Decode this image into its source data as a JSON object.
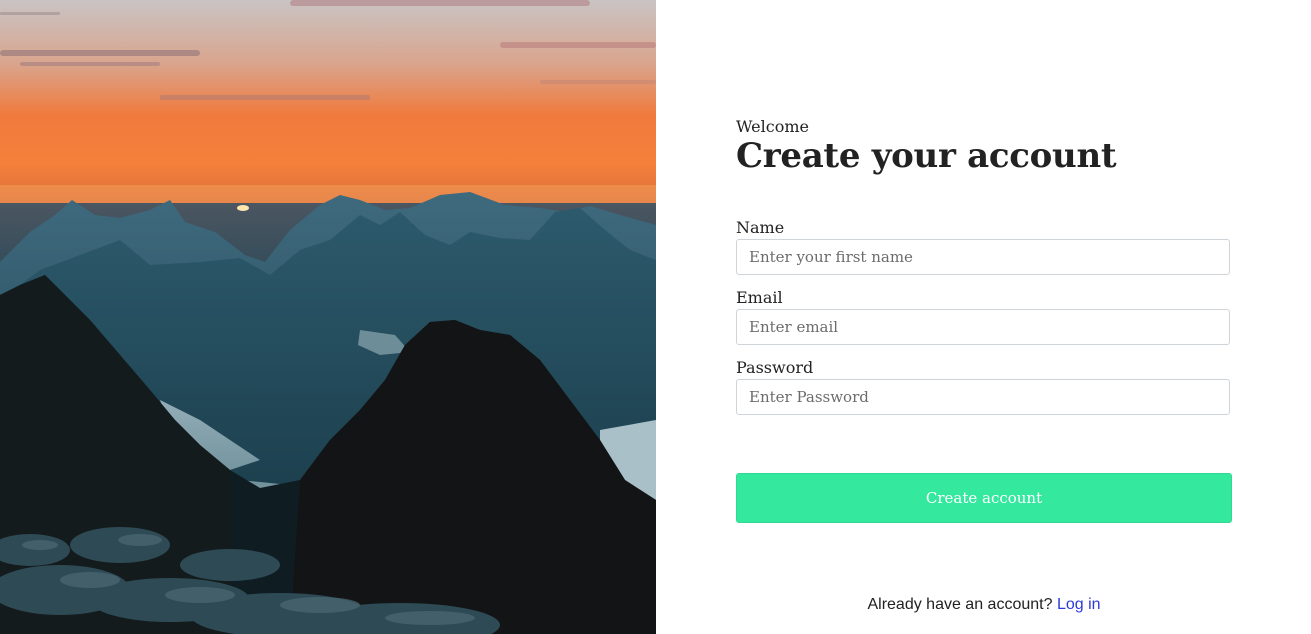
{
  "form": {
    "welcome": "Welcome",
    "title": "Create your account",
    "fields": [
      {
        "label": "Name",
        "placeholder": "Enter your first name",
        "value": ""
      },
      {
        "label": "Email",
        "placeholder": "Enter email",
        "value": ""
      },
      {
        "label": "Password",
        "placeholder": "Enter Password",
        "value": ""
      }
    ],
    "submit_label": "Create account",
    "footer_text": "Already have an account?",
    "login_link": "Log in"
  },
  "colors": {
    "accent": "#34e89e",
    "link": "#2b3bd6",
    "text": "#222222",
    "input_border": "#cfd4d9"
  },
  "hero": {
    "icon": "mountain-sunset-photo"
  }
}
